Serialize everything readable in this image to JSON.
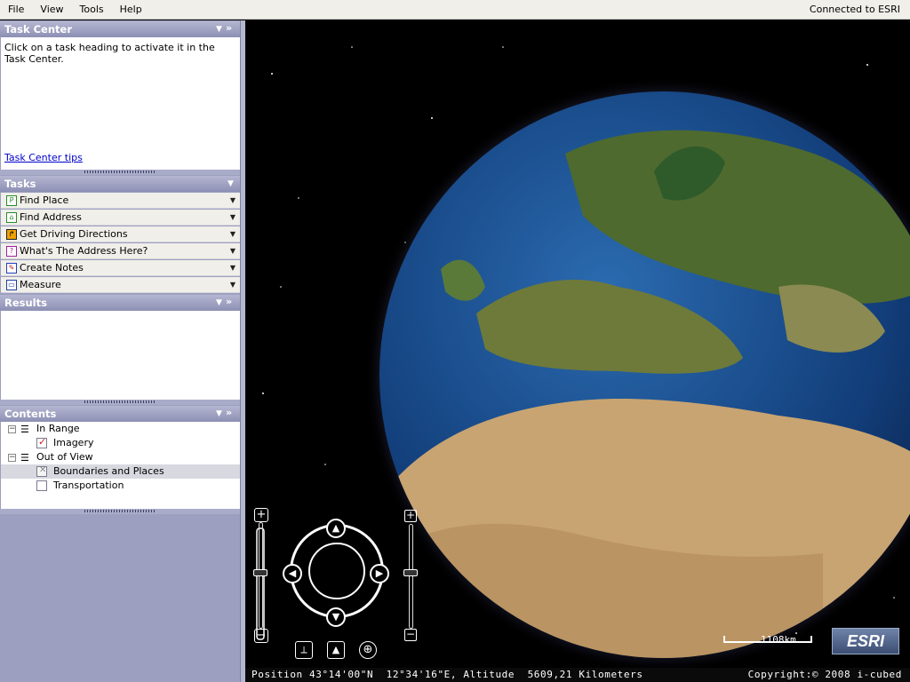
{
  "menu": {
    "items": [
      "File",
      "View",
      "Tools",
      "Help"
    ]
  },
  "connection_status": "Connected to ESRI",
  "task_center": {
    "title": "Task Center",
    "message": "Click on a task heading to activate it in the Task Center.",
    "tips_link": "Task Center tips"
  },
  "tasks": {
    "title": "Tasks",
    "items": [
      {
        "label": "Find Place",
        "icon": "find-place-icon"
      },
      {
        "label": "Find Address",
        "icon": "find-address-icon"
      },
      {
        "label": "Get Driving Directions",
        "icon": "driving-directions-icon"
      },
      {
        "label": "What's The Address Here?",
        "icon": "address-here-icon"
      },
      {
        "label": "Create Notes",
        "icon": "create-notes-icon"
      },
      {
        "label": "Measure",
        "icon": "measure-icon"
      }
    ]
  },
  "results": {
    "title": "Results"
  },
  "contents": {
    "title": "Contents",
    "groups": [
      {
        "label": "In Range",
        "children": [
          {
            "label": "Imagery",
            "checked": true
          }
        ]
      },
      {
        "label": "Out of View",
        "children": [
          {
            "label": "Boundaries and Places",
            "checked": "disabled",
            "selected": true
          },
          {
            "label": "Transportation",
            "checked": false
          }
        ]
      }
    ]
  },
  "map": {
    "scale_label": "1108km",
    "logo": "ESRI",
    "status": {
      "position": "Position 43°14'00\"N  12°34'16\"E, Altitude  5609,21 Kilometers",
      "copyright": "Copyright:© 2008 i-cubed"
    }
  },
  "colors": {
    "panel": "#9c9fbf",
    "header": "#8d90b4",
    "link": "#0000cc"
  }
}
